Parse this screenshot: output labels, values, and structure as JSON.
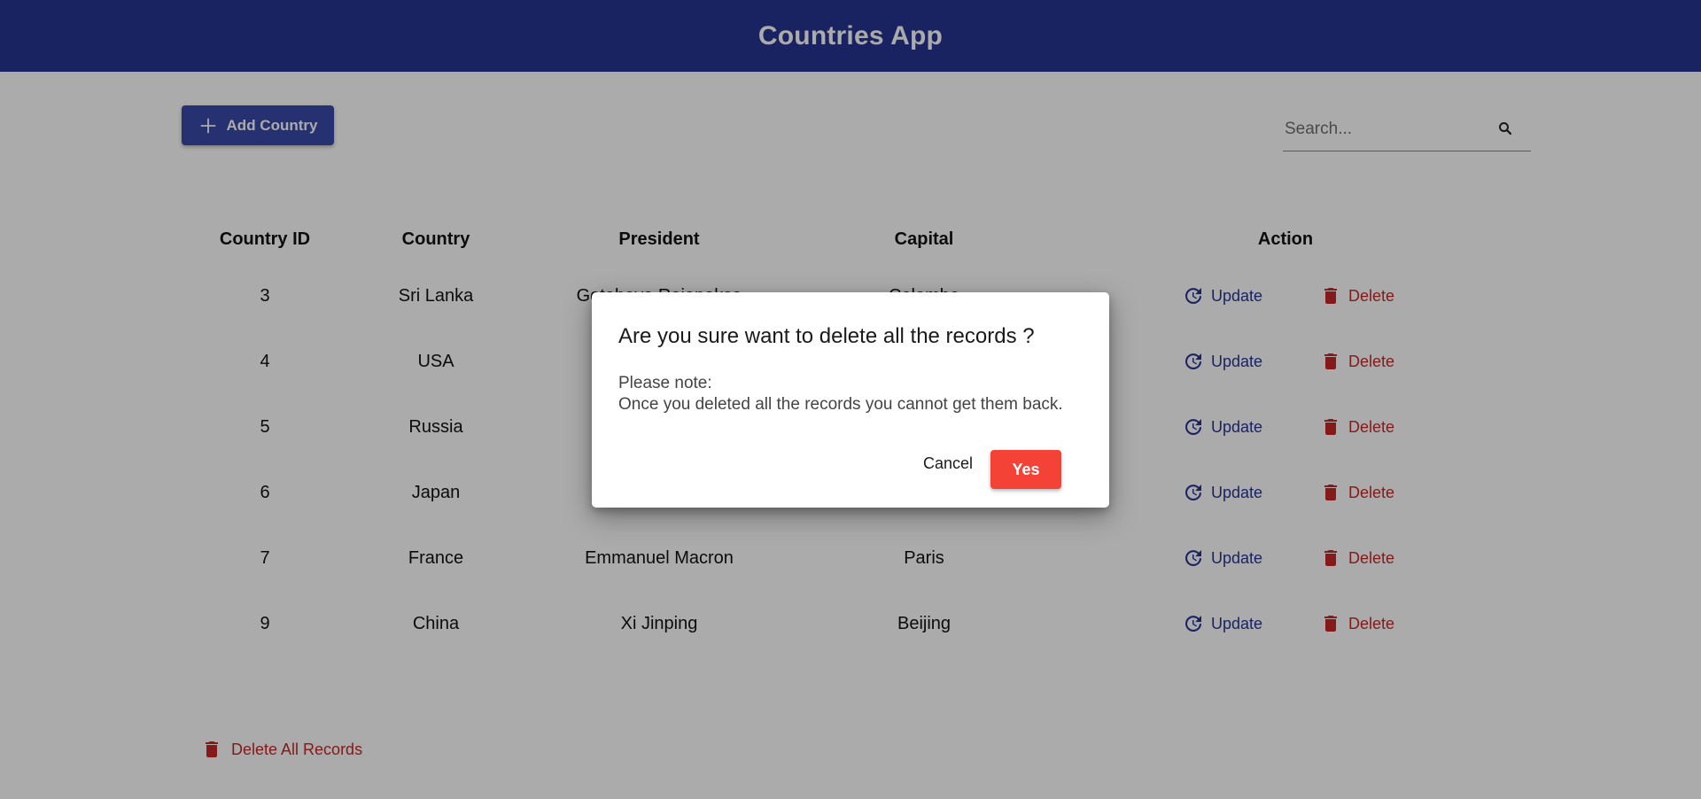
{
  "app": {
    "title": "Countries App"
  },
  "toolbar": {
    "add_label": "Add Country"
  },
  "search": {
    "placeholder": "Search..."
  },
  "table": {
    "columns": [
      "Country ID",
      "Country",
      "President",
      "Capital",
      "Action"
    ],
    "rows": [
      {
        "id": "3",
        "country": "Sri Lanka",
        "president": "Gotabaya Rajapaksa",
        "capital": "Colombo"
      },
      {
        "id": "4",
        "country": "USA",
        "president": "",
        "capital": ""
      },
      {
        "id": "5",
        "country": "Russia",
        "president": "",
        "capital": ""
      },
      {
        "id": "6",
        "country": "Japan",
        "president": "",
        "capital": ""
      },
      {
        "id": "7",
        "country": "France",
        "president": "Emmanuel Macron",
        "capital": "Paris"
      },
      {
        "id": "9",
        "country": "China",
        "president": "Xi Jinping",
        "capital": "Beijing"
      }
    ],
    "update_label": "Update",
    "delete_label": "Delete"
  },
  "footer": {
    "delete_all_label": "Delete All Records"
  },
  "dialog": {
    "title": "Are you sure want to delete all the records ?",
    "note_line1": "Please note:",
    "note_line2": "Once you deleted all the records you cannot get them back.",
    "cancel_label": "Cancel",
    "yes_label": "Yes"
  },
  "colors": {
    "appbar": "#283593",
    "primary_button": "#3949ab",
    "update": "#283593",
    "delete": "#c62828",
    "confirm": "#f44336"
  },
  "icons": {
    "add": "plus-icon",
    "search": "search-icon",
    "update": "update-icon",
    "delete": "trash-icon"
  }
}
